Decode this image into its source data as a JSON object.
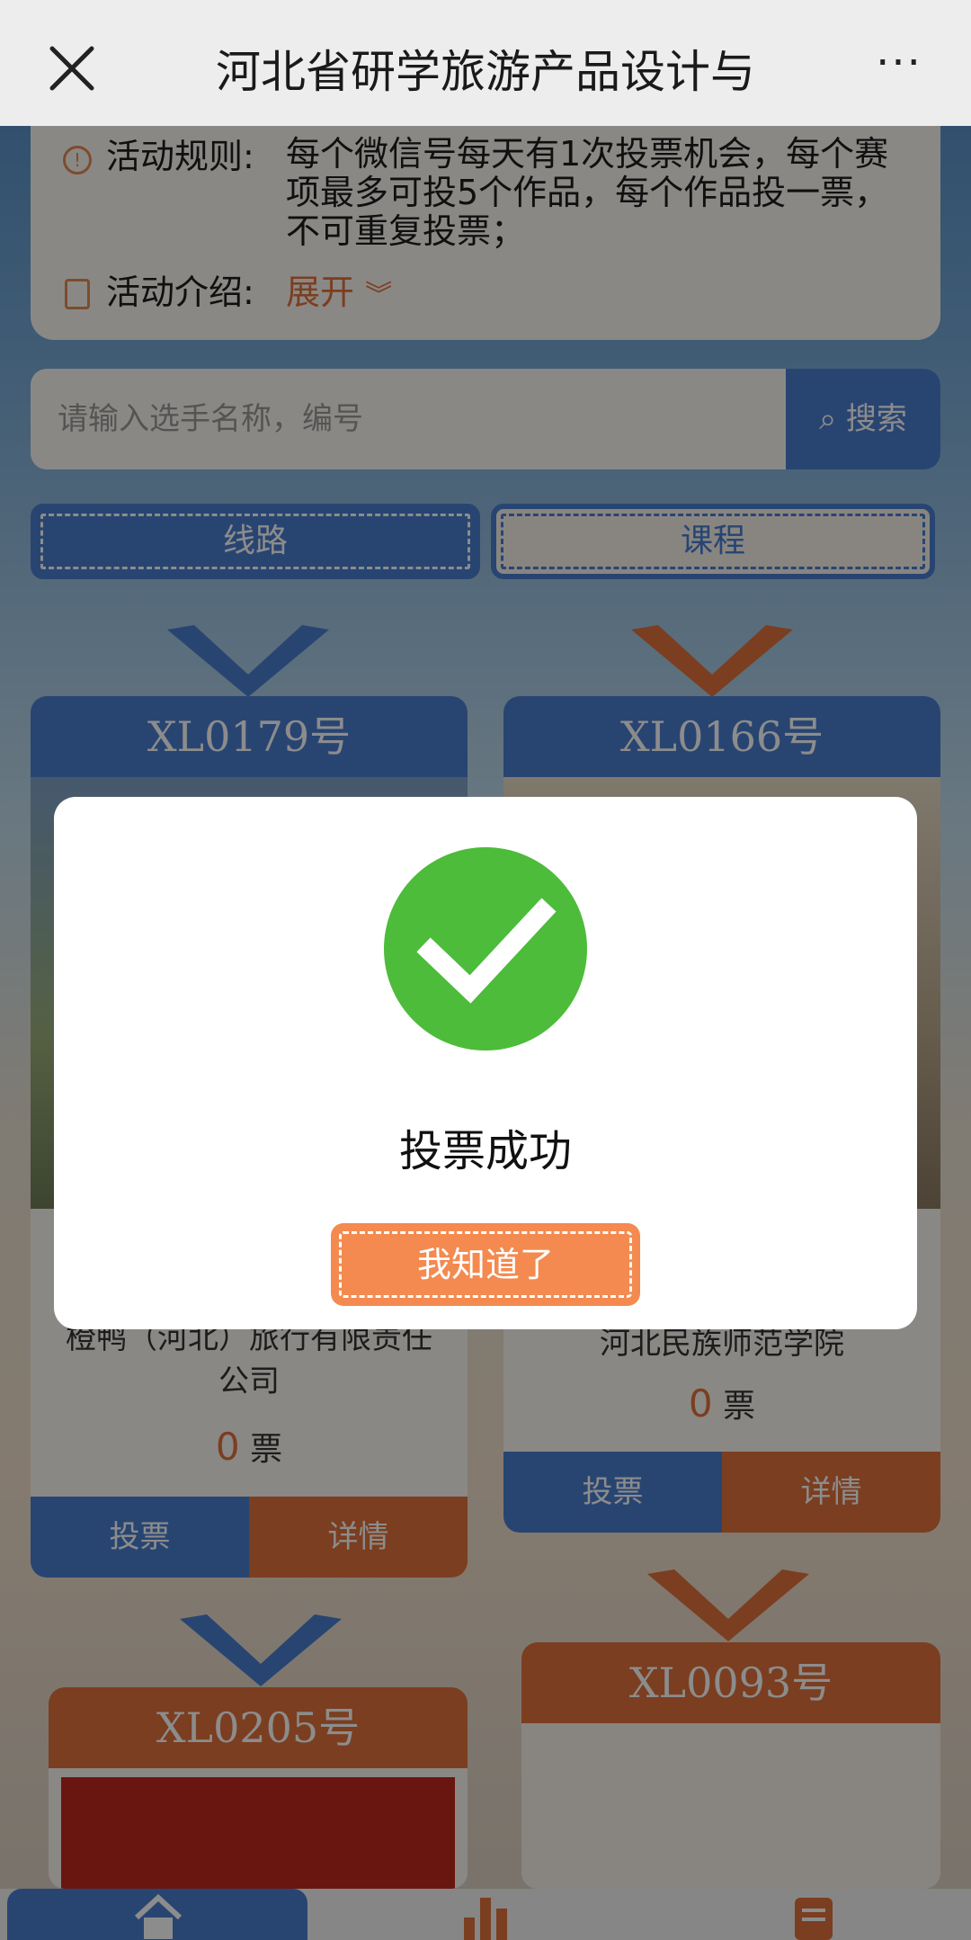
{
  "topbar": {
    "title": "河北省研学旅游产品设计与",
    "more": "···"
  },
  "rules": {
    "rule_label": "活动规则:",
    "rule_text": "每个微信号每天有1次投票机会，每个赛项最多可投5个作品，每个作品投一票，不可重复投票；",
    "intro_label": "活动介绍:",
    "expand_label": "展开"
  },
  "search": {
    "placeholder": "请输入选手名称，编号",
    "button": "搜索"
  },
  "tabs": [
    "线路",
    "课程"
  ],
  "cards": [
    {
      "id": "XL0179号",
      "org": "橙鸭（河北）旅行有限责任公司",
      "votes": "0",
      "unit": "票",
      "vote_btn": "投票",
      "detail_btn": "详情"
    },
    {
      "id": "XL0166号",
      "org": "河北民族师范学院",
      "votes": "0",
      "unit": "票",
      "vote_btn": "投票",
      "detail_btn": "详情"
    },
    {
      "id": "XL0205号"
    },
    {
      "id": "XL0093号"
    }
  ],
  "modal": {
    "message": "投票成功",
    "ok_button": "我知道了"
  },
  "colors": {
    "blue": "#4a7ed0",
    "orange": "#e0723b",
    "success": "#4cbc3a"
  }
}
